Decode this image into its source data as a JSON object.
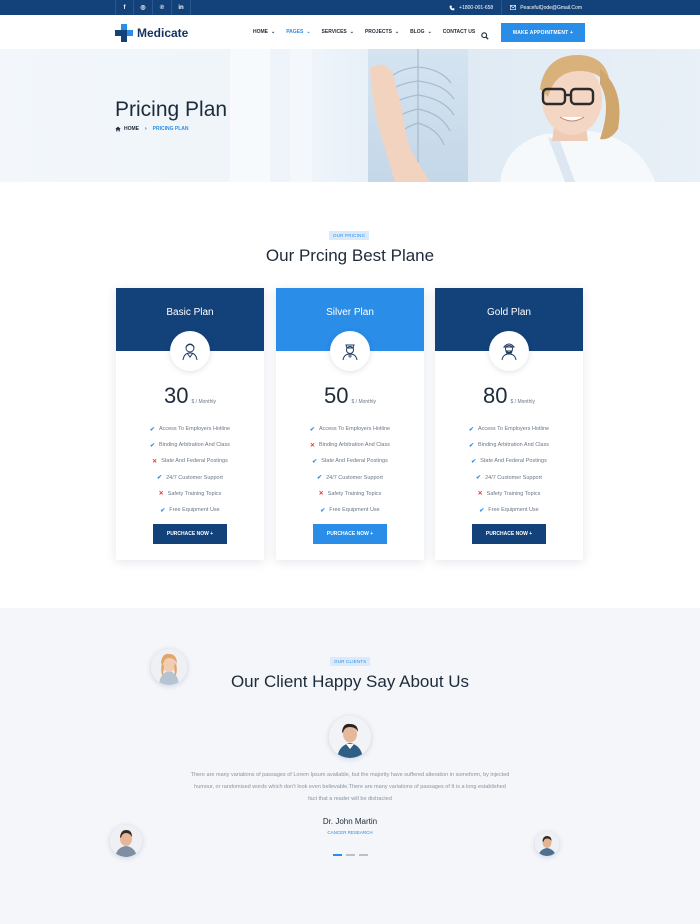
{
  "topbar": {
    "social": [
      "f",
      "◎",
      "℗",
      "in"
    ],
    "phone": "+1800-001-658",
    "email": "PeacefulQode@Gmail.Com"
  },
  "header": {
    "brand": "Medicate",
    "nav": [
      {
        "label": "HOME",
        "caret": true,
        "active": false
      },
      {
        "label": "PAGES",
        "caret": true,
        "active": true
      },
      {
        "label": "SERVICES",
        "caret": true,
        "active": false
      },
      {
        "label": "PROJECTS",
        "caret": true,
        "active": false
      },
      {
        "label": "BLOG",
        "caret": true,
        "active": false
      },
      {
        "label": "CONTACT US",
        "caret": false,
        "active": false
      }
    ],
    "cta": "MAKE APPOINTMENT +"
  },
  "banner": {
    "title": "Pricing Plan",
    "crumb_home": "HOME",
    "crumb_current": "PRICING PLAN"
  },
  "pricing": {
    "tag": "OUR PRICING",
    "title": "Our Prcing Best Plane",
    "plans": [
      {
        "name": "Basic Plan",
        "price": "30",
        "period": "$ / Monthly",
        "style": "dark",
        "features": [
          {
            "text": "Access To Employers Hotline",
            "ok": true
          },
          {
            "text": "Binding Arbitration And Class",
            "ok": true
          },
          {
            "text": "State And Federal Postings",
            "ok": false
          },
          {
            "text": "24/7 Customer Support",
            "ok": true
          },
          {
            "text": "Safety Training Topics",
            "ok": false
          },
          {
            "text": "Free Equipment Use",
            "ok": true
          }
        ],
        "button": "PURCHACE NOW +"
      },
      {
        "name": "Silver Plan",
        "price": "50",
        "period": "$ / Monthly",
        "style": "light",
        "features": [
          {
            "text": "Access To Employers Hotline",
            "ok": true
          },
          {
            "text": "Binding Arbitration And Class",
            "ok": false
          },
          {
            "text": "State And Federal Postings",
            "ok": true
          },
          {
            "text": "24/7 Customer Support",
            "ok": true
          },
          {
            "text": "Safety Training Topics",
            "ok": false
          },
          {
            "text": "Free Equipment Use",
            "ok": true
          }
        ],
        "button": "PURCHACE NOW +"
      },
      {
        "name": "Gold Plan",
        "price": "80",
        "period": "$ / Monthly",
        "style": "dark",
        "features": [
          {
            "text": "Access To Employers Hotline",
            "ok": true
          },
          {
            "text": "Binding Arbitration And Class",
            "ok": true
          },
          {
            "text": "State And Federal Postings",
            "ok": true
          },
          {
            "text": "24/7 Customer Support",
            "ok": true
          },
          {
            "text": "Safety Training Topics",
            "ok": false
          },
          {
            "text": "Free Equipment Use",
            "ok": true
          }
        ],
        "button": "PURCHACE NOW +"
      }
    ]
  },
  "clients": {
    "tag": "OUR CLIENTS",
    "title": "Our Client Happy Say About Us",
    "quote": "There are many variations of passages of Lorem Ipsum available, but the majority have suffered alteration in someform, by injected humour, or randomised words which don't look even believable.There are many variations of passages of It is a long established fact that a reader will be distracted",
    "author": "Dr. John Martin",
    "role": "CANCER RESEARCH",
    "slides": 3,
    "active_slide": 0
  },
  "colors": {
    "navy": "#13427a",
    "accent": "#2a8de8",
    "cross": "#e53935"
  }
}
